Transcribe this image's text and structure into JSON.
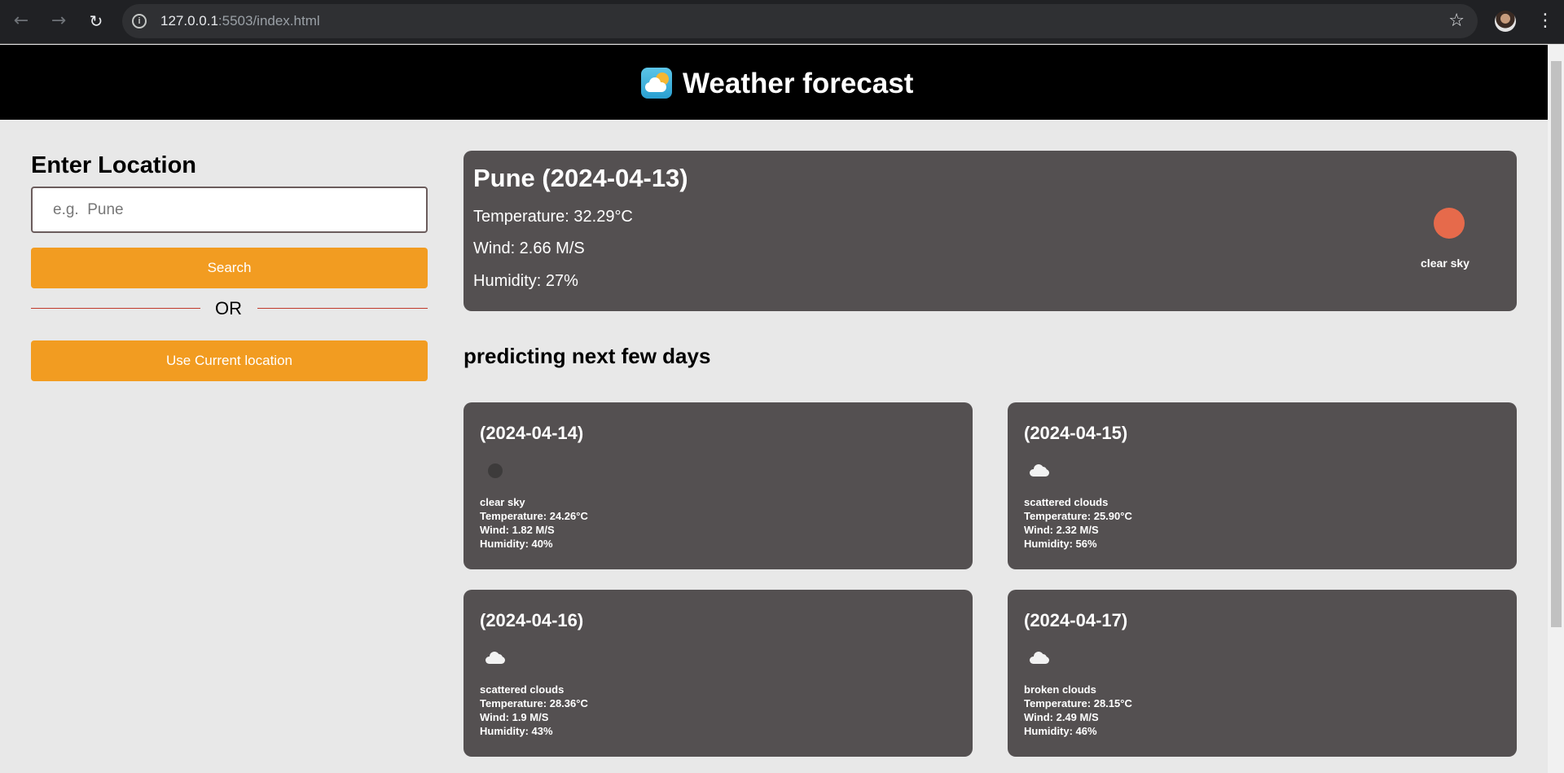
{
  "browser": {
    "url_host": "127.0.0.1",
    "url_rest": ":5503/index.html"
  },
  "header": {
    "title": "Weather forecast"
  },
  "search": {
    "heading": "Enter Location",
    "placeholder": "e.g.  Pune",
    "value": "",
    "search_label": "Search",
    "or_label": "OR",
    "current_location_label": "Use Current location"
  },
  "current": {
    "title": "Pune (2024-04-13)",
    "temperature": "Temperature: 32.29°C",
    "wind": "Wind: 2.66 M/S",
    "humidity": "Humidity: 27%",
    "description": "clear sky",
    "icon": "clear-sky-sun-icon"
  },
  "forecast": {
    "heading": "predicting next few days",
    "days": [
      {
        "date": "(2024-04-14)",
        "icon": "clear-sky-night-icon",
        "description": "clear sky",
        "temperature": "Temperature: 24.26°C",
        "wind": "Wind: 1.82 M/S",
        "humidity": "Humidity: 40%"
      },
      {
        "date": "(2024-04-15)",
        "icon": "cloud-icon",
        "description": "scattered clouds",
        "temperature": "Temperature: 25.90°C",
        "wind": "Wind: 2.32 M/S",
        "humidity": "Humidity: 56%"
      },
      {
        "date": "(2024-04-16)",
        "icon": "cloud-icon",
        "description": "scattered clouds",
        "temperature": "Temperature: 28.36°C",
        "wind": "Wind: 1.9 M/S",
        "humidity": "Humidity: 43%"
      },
      {
        "date": "(2024-04-17)",
        "icon": "cloud-icon",
        "description": "broken clouds",
        "temperature": "Temperature: 28.15°C",
        "wind": "Wind: 2.49 M/S",
        "humidity": "Humidity: 46%"
      }
    ]
  },
  "colors": {
    "accent": "#f29c21",
    "card": "#545051",
    "header": "#000000",
    "sun": "#e66a4b"
  }
}
